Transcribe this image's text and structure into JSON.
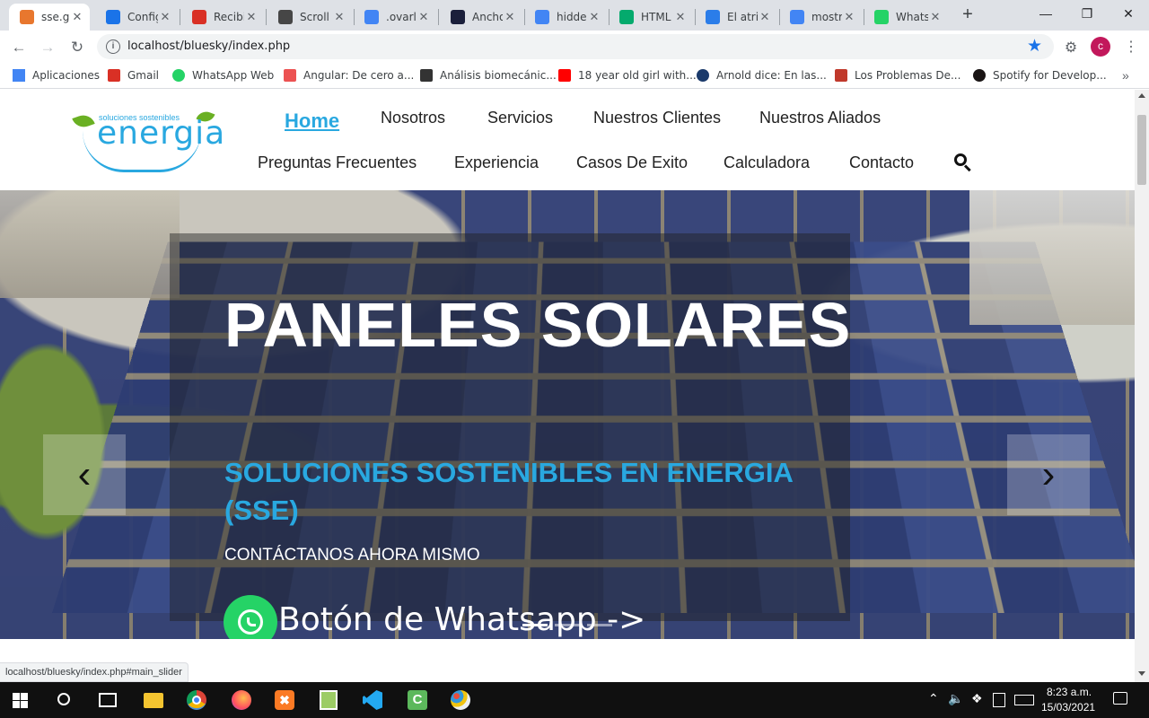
{
  "tabs": [
    {
      "label": "sse.gr",
      "icon": "sse-favicon-icon",
      "color": "#e8772e",
      "active": true
    },
    {
      "label": "Config",
      "icon": "gear-favicon-icon",
      "color": "#1a73e8"
    },
    {
      "label": "Recibi",
      "icon": "gmail-favicon-icon",
      "color": "#d93025"
    },
    {
      "label": "Scroll",
      "icon": "wordpress-favicon-icon",
      "color": "#464646"
    },
    {
      "label": ".ovarla",
      "icon": "google-favicon-icon",
      "color": "#4285f4"
    },
    {
      "label": "Ancho",
      "icon": "angular-favicon-icon",
      "color": "#1b1f3b"
    },
    {
      "label": "hidde",
      "icon": "google-favicon-icon",
      "color": "#4285f4"
    },
    {
      "label": "HTML",
      "icon": "w3-favicon-icon",
      "color": "#04aa6d"
    },
    {
      "label": "El atri",
      "icon": "d-favicon-icon",
      "color": "#2b7de9"
    },
    {
      "label": "mostr",
      "icon": "google-favicon-icon",
      "color": "#4285f4"
    },
    {
      "label": "Whats",
      "icon": "whatsapp-favicon-icon",
      "color": "#25d366"
    }
  ],
  "address_bar": {
    "url": "localhost/bluesky/index.php"
  },
  "profile_initial": "c",
  "bookmarks": [
    {
      "label": "Aplicaciones",
      "icon": "apps-grid-icon",
      "color": "#4285f4"
    },
    {
      "label": "Gmail",
      "icon": "gmail-icon",
      "color": "#d93025"
    },
    {
      "label": "WhatsApp Web",
      "icon": "whatsapp-icon",
      "color": "#25d366"
    },
    {
      "label": "Angular: De cero a...",
      "icon": "udemy-icon",
      "color": "#ec5252"
    },
    {
      "label": "Análisis biomecánic...",
      "icon": "pkp-icon",
      "color": "#333333"
    },
    {
      "label": "18 year old girl with...",
      "icon": "youtube-icon",
      "color": "#ff0000"
    },
    {
      "label": "Arnold dice: En las...",
      "icon": "globe-icon",
      "color": "#1b3a6b"
    },
    {
      "label": "Los Problemas De...",
      "icon": "site-icon",
      "color": "#c0392b"
    },
    {
      "label": "Spotify for Develop...",
      "icon": "spotify-icon",
      "color": "#191414"
    }
  ],
  "site": {
    "logo_small": "soluciones sostenibles",
    "logo_main": "energia",
    "nav_row1": [
      "Home",
      "Nosotros",
      "Servicios",
      "Nuestros Clientes",
      "Nuestros Aliados"
    ],
    "nav_row2": [
      "Preguntas Frecuentes",
      "Experiencia",
      "Casos De Exito",
      "Calculadora",
      "Contacto"
    ]
  },
  "hero": {
    "title": "PANELES SOLARES",
    "subtitle": "SOLUCIONES SOSTENIBLES EN ENERGIA (SSE)",
    "cta_text": "CONTÁCTANOS AHORA MISMO",
    "whatsapp_button": "Botón de Whatsapp ->"
  },
  "status_url": "localhost/bluesky/index.php#main_slider",
  "taskbar": {
    "time": "8:23 a.m.",
    "date": "15/03/2021"
  },
  "colors": {
    "accent": "#29a8e0",
    "whatsapp": "#25d366",
    "logo_green": "#6ab023"
  }
}
